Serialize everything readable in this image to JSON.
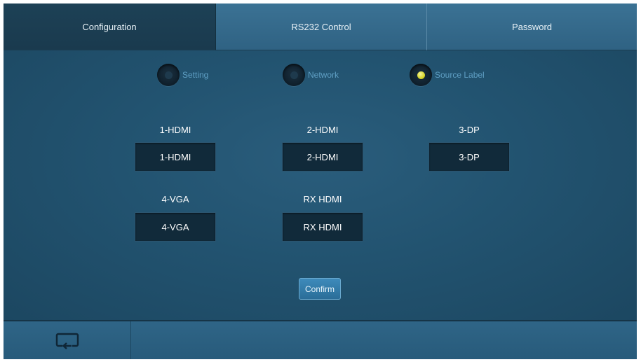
{
  "tabs": [
    {
      "label": "Configuration",
      "active": true
    },
    {
      "label": "RS232 Control",
      "active": false
    },
    {
      "label": "Password",
      "active": false
    }
  ],
  "radios": [
    {
      "label": "Setting",
      "selected": false
    },
    {
      "label": "Network",
      "selected": false
    },
    {
      "label": "Source Label",
      "selected": true
    }
  ],
  "sources": [
    {
      "label": "1-HDMI",
      "value": "1-HDMI"
    },
    {
      "label": "2-HDMI",
      "value": "2-HDMI"
    },
    {
      "label": "3-DP",
      "value": "3-DP"
    },
    {
      "label": "4-VGA",
      "value": "4-VGA"
    },
    {
      "label": "RX HDMI",
      "value": "RX HDMI"
    }
  ],
  "confirm_label": "Confirm",
  "footer": {
    "back_icon": "return-icon"
  },
  "colors": {
    "background": "#1f4a63",
    "tab_inactive": "#3b7294",
    "tab_active": "#1d4156",
    "field_bg": "#112a3a",
    "radio_selected": "#d9d62a",
    "radio_label": "#5f9fc4"
  }
}
